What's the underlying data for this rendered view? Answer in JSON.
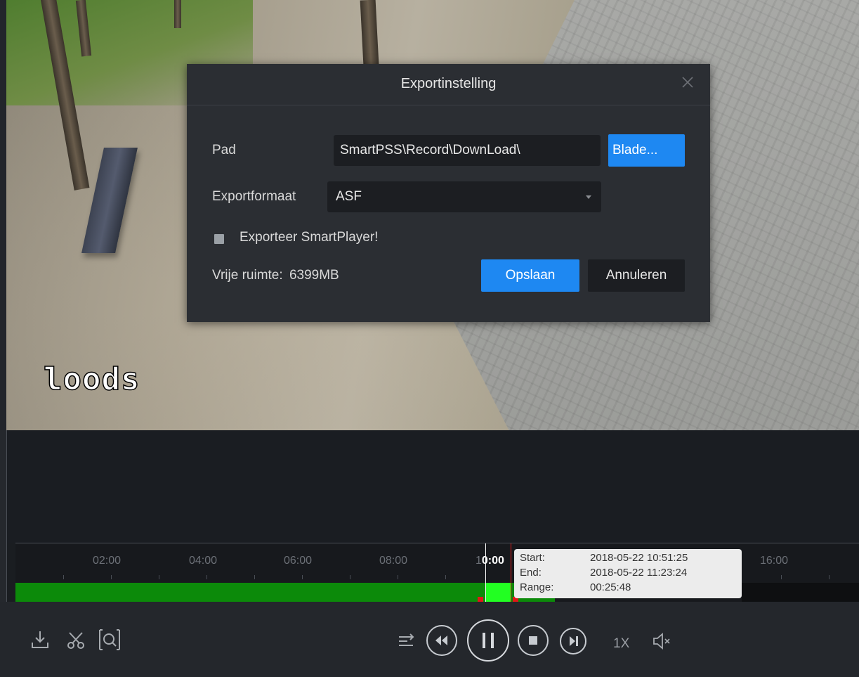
{
  "video": {
    "overlay_label": "loods"
  },
  "dialog": {
    "title": "Exportinstelling",
    "path_label": "Pad",
    "path_value": "SmartPSS\\Record\\DownLoad\\",
    "browse_label": "Blade...",
    "format_label": "Exportformaat",
    "format_value": "ASF",
    "export_player_label": "Exporteer SmartPlayer!",
    "free_space_label": "Vrije ruimte:",
    "free_space_value": "6399MB",
    "save_label": "Opslaan",
    "cancel_label": "Annuleren"
  },
  "timeline": {
    "ticks": [
      "02:00",
      "04:00",
      "06:00",
      "08:00",
      "16:00"
    ],
    "current_tick_prefix": "1",
    "current_tick_bold": "0:00",
    "tooltip": {
      "start_label": "Start:",
      "start_value": "2018-05-22 10:51:25",
      "end_label": "End:",
      "end_value": "2018-05-22 11:23:24",
      "range_label": "Range:",
      "range_value": "00:25:48"
    }
  },
  "controls": {
    "speed": "1X",
    "icons": [
      "download-icon",
      "scissors-icon",
      "smart-search-icon",
      "sync-icon",
      "rewind-icon",
      "pause-icon",
      "stop-icon",
      "next-frame-icon",
      "mute-icon"
    ]
  },
  "colors": {
    "accent": "#1e88f2",
    "record": "#0c8a0a",
    "selection": "#22ff22",
    "marker": "#e01818"
  }
}
